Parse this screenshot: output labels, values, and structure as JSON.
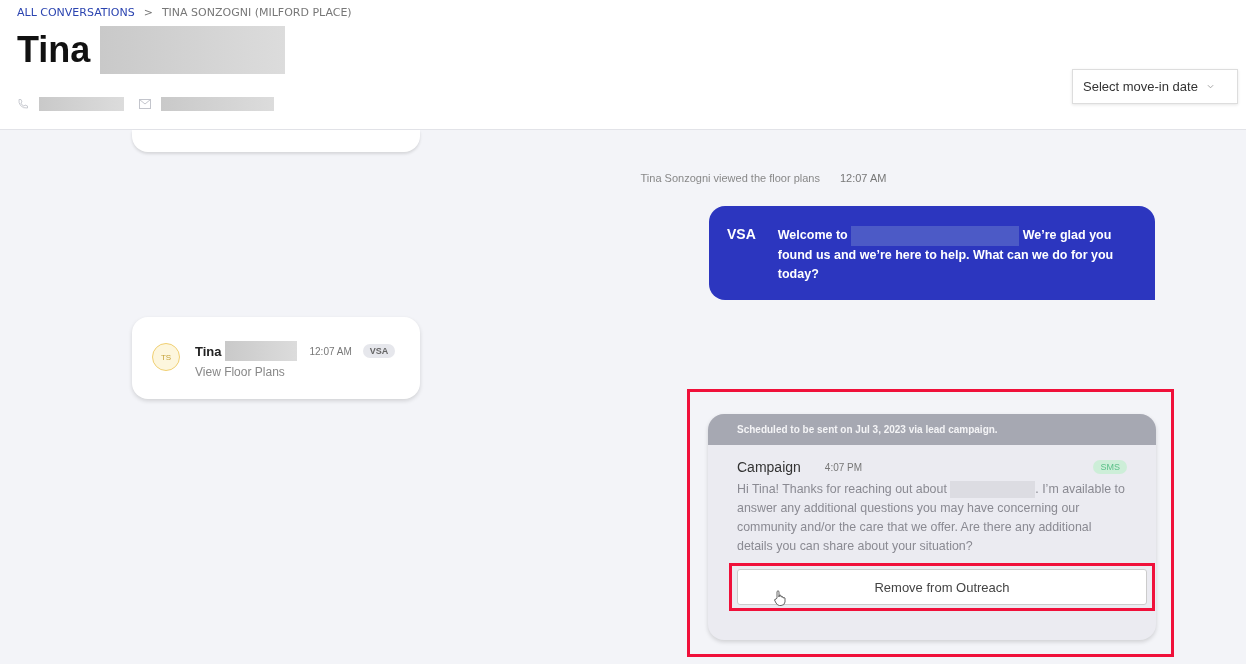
{
  "breadcrumb": {
    "link": "ALL CONVERSATIONS",
    "separator": ">",
    "current": "TINA SONZOGNI (MILFORD PLACE)"
  },
  "contact": {
    "first_name": "Tina"
  },
  "move_in_select": {
    "placeholder": "Select move-in date"
  },
  "events": [
    {
      "kind": "activity",
      "text": "Tina Sonzogni viewed the floor plans",
      "time": "12:07 AM"
    },
    {
      "kind": "outgoing",
      "sender": "VSA",
      "text_before": "Welcome to",
      "text_after": "We’re glad you found us and we’re here to help. What can we do for you today?"
    },
    {
      "kind": "card",
      "initials": "TS",
      "name": "Tina",
      "time": "12:07 AM",
      "tag": "VSA",
      "text": "View Floor Plans"
    },
    {
      "kind": "scheduled",
      "banner": "Scheduled to be sent on Jul 3, 2023 via lead campaign.",
      "title": "Campaign",
      "time": "4:07 PM",
      "channel": "SMS",
      "text_before": "Hi Tina! Thanks for reaching out about",
      "text_after": ". I’m available to answer any additional questions you may have concerning our community and/or the care that we offer. Are there any additional details you can share about your situation?",
      "button": "Remove from Outreach",
      "highlighted": true
    }
  ]
}
